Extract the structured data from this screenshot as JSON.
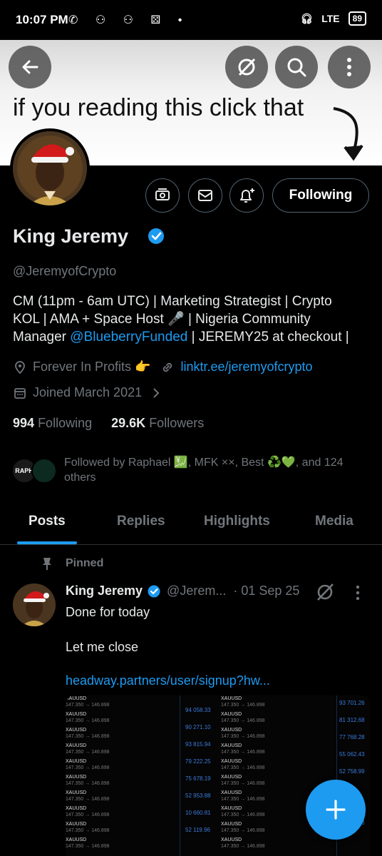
{
  "status_bar": {
    "time": "10:07 PM",
    "battery": "89",
    "network": "LTE"
  },
  "banner": {
    "text": "if you reading this click that"
  },
  "profile": {
    "name": "King Jeremy",
    "handle": "@JeremyofCrypto",
    "bio_line1": "CM (11pm - 6am UTC) | Marketing Strategist | Crypto",
    "bio_line2": "KOL | AMA + Space Host 🎤 | Nigeria Community",
    "bio_line3_prefix": "Manager ",
    "bio_mention": "@BlueberryFunded",
    "bio_line3_suffix": " | JEREMY25 at checkout |",
    "location": "Forever In Profits 👉",
    "website": "linktr.ee/jeremyofcrypto",
    "joined": "Joined March 2021",
    "following_count": "994",
    "following_label": "Following",
    "followers_count": "29.6K",
    "followers_label": "Followers",
    "followed_by": "Followed by Raphael  💹, MFK ××, Best ♻️💚, and 124 others",
    "following_button": "Following"
  },
  "tabs": [
    {
      "label": "Posts",
      "active": true
    },
    {
      "label": "Replies",
      "active": false
    },
    {
      "label": "Highlights",
      "active": false
    },
    {
      "label": "Media",
      "active": false
    }
  ],
  "post": {
    "pinned_label": "Pinned",
    "author_name": "King Jeremy",
    "author_handle": "@Jerem...",
    "date": "· 01 Sep 25",
    "line1": "Done for today",
    "line2": "Let me close",
    "link": "headway.partners/user/signup?hw..."
  },
  "media": {
    "row_title": "XAUUSD",
    "row_sub": "147.350 → 146.898",
    "values_left": [
      "94 058.33",
      "90 271.10",
      "93 815.94",
      "79 222.25",
      "75 678.19",
      "52 953.88",
      "10 660.81",
      "52 119.96"
    ],
    "values_right": [
      "93 701.26",
      "81 312.68",
      "77 768.28",
      "55 062.43",
      "52 758.99",
      "",
      "",
      "19 802.33"
    ]
  },
  "colors": {
    "accent": "#1d9bf0",
    "muted": "#71767b",
    "text": "#e7e9ea"
  }
}
